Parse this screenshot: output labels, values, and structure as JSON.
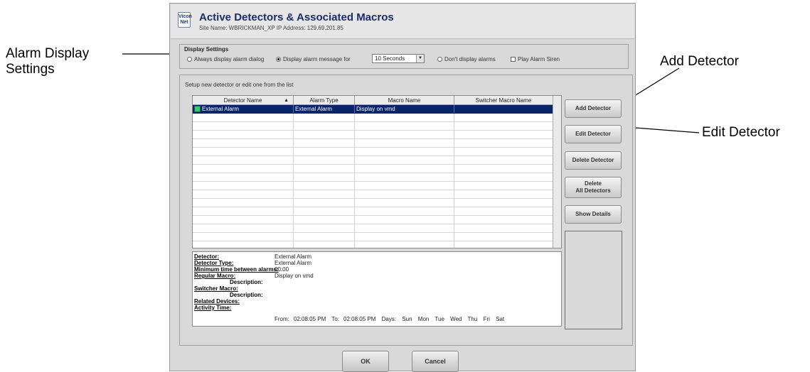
{
  "callouts": {
    "alarm_display_line1": "Alarm Display",
    "alarm_display_line2": "Settings",
    "add_detector": "Add Detector",
    "edit_detector": "Edit Detector"
  },
  "header": {
    "logo": "Vicon Net",
    "title": "Active Detectors & Associated Macros",
    "subtitle": "Site Name: WBRICKMAN_XP   IP Address: 129.69.201.85"
  },
  "display_settings": {
    "label": "Display Settings",
    "option_always": "Always display alarm dialog",
    "option_message": "Display alarm message for",
    "duration": "10 Seconds",
    "option_dont": "Don't display alarms",
    "play_siren": "Play Alarm Siren",
    "selected": "message"
  },
  "setup_label": "Setup new detector or edit one from the list",
  "table": {
    "columns": [
      "Detector Name",
      "Alarm Type",
      "Macro Name",
      "Switcher Macro Name"
    ],
    "rows": [
      [
        "External Alarm",
        "External Alarm",
        "Display on vmd",
        ""
      ]
    ]
  },
  "details": {
    "detector_label": "Detector:",
    "detector_value": "External Alarm",
    "type_label": "Detector Type:",
    "type_value": "External Alarm",
    "min_time_label": "Minimum time between alarms:",
    "min_time_value": "00:00",
    "regular_macro_label": "Regular Macro:",
    "regular_macro_value": "Display on vmd",
    "description_label": "Description:",
    "switcher_macro_label": "Switcher Macro:",
    "description2_label": "Description:",
    "related_label": "Related Devices:",
    "activity_label": "Activity Time:",
    "from_label": "From:",
    "from_value": "02:08:05 PM",
    "to_label": "To:",
    "to_value": "02:08:05 PM",
    "days_label": "Days:",
    "days": [
      "Sun",
      "Mon",
      "Tue",
      "Wed",
      "Thu",
      "Fri",
      "Sat"
    ]
  },
  "buttons": {
    "add": "Add Detector",
    "edit": "Edit Detector",
    "delete": "Delete Detector",
    "delete_all_1": "Delete",
    "delete_all_2": "All Detectors",
    "show": "Show Details",
    "ok": "OK",
    "cancel": "Cancel"
  }
}
